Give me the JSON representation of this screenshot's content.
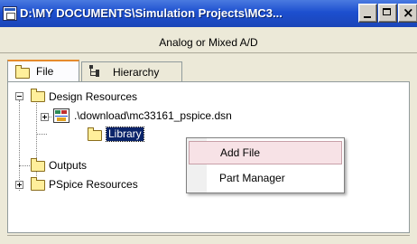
{
  "window": {
    "title": "D:\\MY DOCUMENTS\\Simulation Projects\\MC3...",
    "subtitle": "Analog or Mixed A/D",
    "close_glyph": "×"
  },
  "tabs": [
    {
      "label": "File",
      "icon": "folder-icon",
      "active": true
    },
    {
      "label": "Hierarchy",
      "icon": "hierarchy-icon",
      "active": false
    }
  ],
  "tree": {
    "design_resources": "Design Resources",
    "dsn_file": ".\\download\\mc33161_pspice.dsn",
    "library": "Library",
    "outputs": "Outputs",
    "pspice_resources": "PSpice Resources"
  },
  "context_menu": {
    "items": [
      {
        "label": "Add File",
        "highlighted": true
      },
      {
        "label": "Part Manager",
        "highlighted": false
      }
    ]
  },
  "colors": {
    "titlebar": "#1d4fcf",
    "selection": "#0a246a",
    "menu_highlight": "#f7e2e6",
    "folder": "#ffef9b",
    "tab_accent": "#e68b2c"
  }
}
